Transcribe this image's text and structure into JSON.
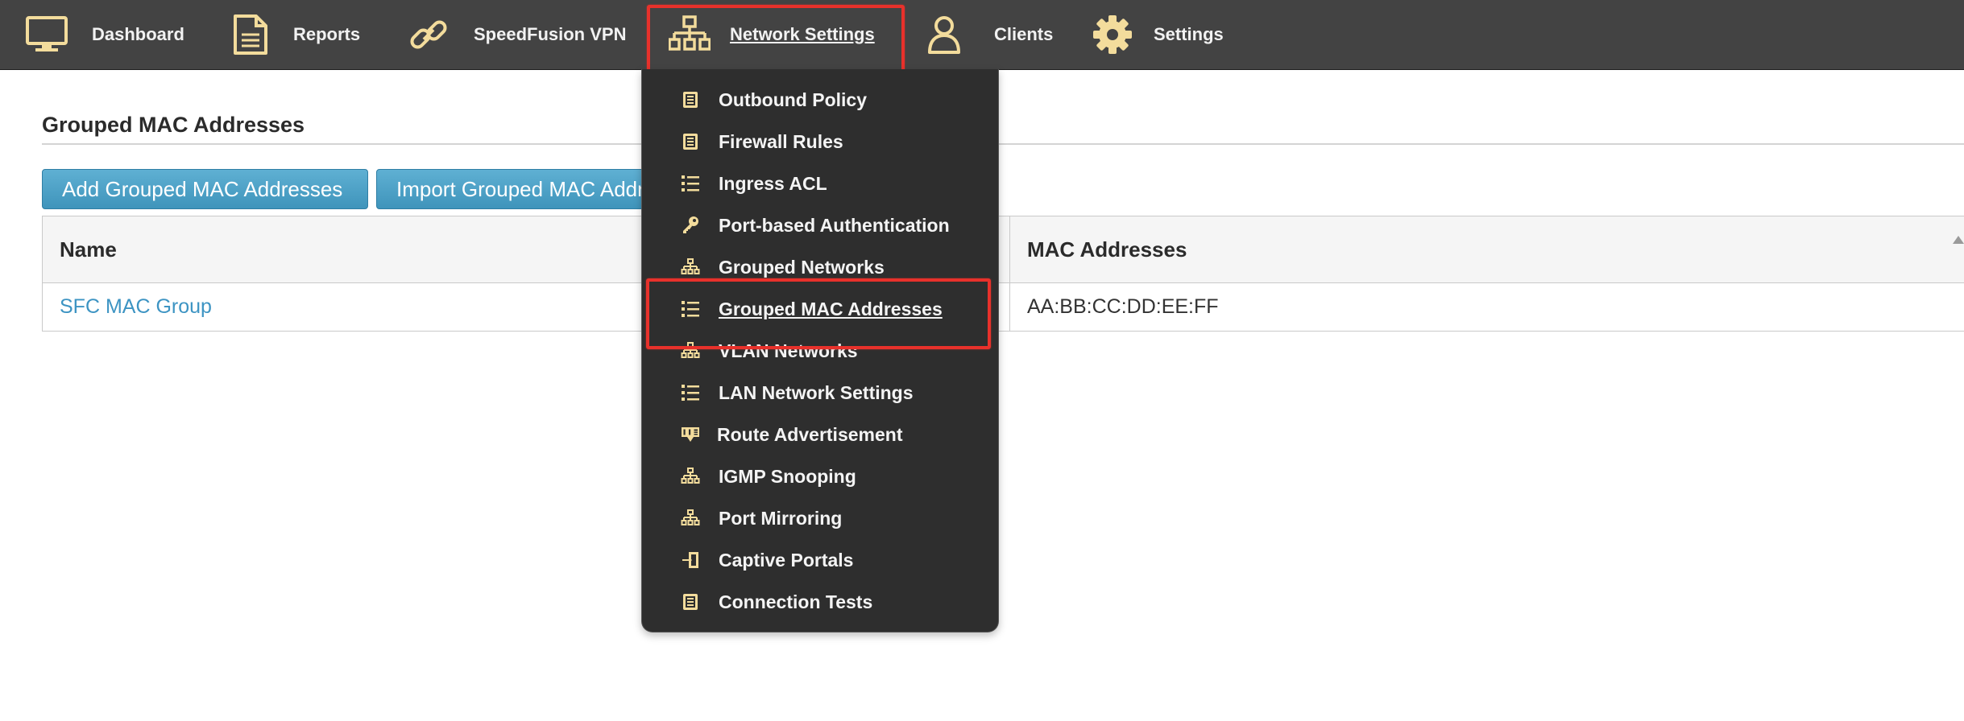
{
  "nav": {
    "items": [
      {
        "label": "Dashboard",
        "icon": "monitor-icon"
      },
      {
        "label": "Reports",
        "icon": "document-icon"
      },
      {
        "label": "SpeedFusion VPN",
        "icon": "link-icon"
      },
      {
        "label": "Network Settings",
        "icon": "network-icon",
        "active": true
      },
      {
        "label": "Clients",
        "icon": "user-icon"
      },
      {
        "label": "Settings",
        "icon": "gear-icon"
      }
    ]
  },
  "dropdown": {
    "items": [
      {
        "label": "Outbound Policy",
        "icon": "list-doc-icon"
      },
      {
        "label": "Firewall Rules",
        "icon": "list-doc-icon"
      },
      {
        "label": "Ingress ACL",
        "icon": "bullet-list-icon"
      },
      {
        "label": "Port-based Authentication",
        "icon": "key-icon"
      },
      {
        "label": "Grouped Networks",
        "icon": "network-icon"
      },
      {
        "label": "Grouped MAC Addresses",
        "icon": "bullet-list-icon",
        "selected": true
      },
      {
        "label": "VLAN Networks",
        "icon": "network-icon"
      },
      {
        "label": "LAN Network Settings",
        "icon": "bullet-list-icon"
      },
      {
        "label": "Route Advertisement",
        "icon": "ads-badge-icon"
      },
      {
        "label": "IGMP Snooping",
        "icon": "network-icon"
      },
      {
        "label": "Port Mirroring",
        "icon": "network-icon"
      },
      {
        "label": "Captive Portals",
        "icon": "door-enter-icon"
      },
      {
        "label": "Connection Tests",
        "icon": "list-doc-icon"
      }
    ]
  },
  "page": {
    "title": "Grouped MAC Addresses",
    "add_button": "Add Grouped MAC Addresses",
    "import_button": "Import Grouped MAC Addresses"
  },
  "table": {
    "columns": [
      "Name",
      "MAC Addresses"
    ],
    "rows": [
      {
        "name": "SFC MAC Group",
        "mac": "AA:BB:CC:DD:EE:FF"
      }
    ]
  },
  "colors": {
    "nav_bg": "#434343",
    "icon_accent": "#f3dc9c",
    "highlight": "#e8312b",
    "button": "#4a9fc6",
    "link": "#3d94c3"
  }
}
